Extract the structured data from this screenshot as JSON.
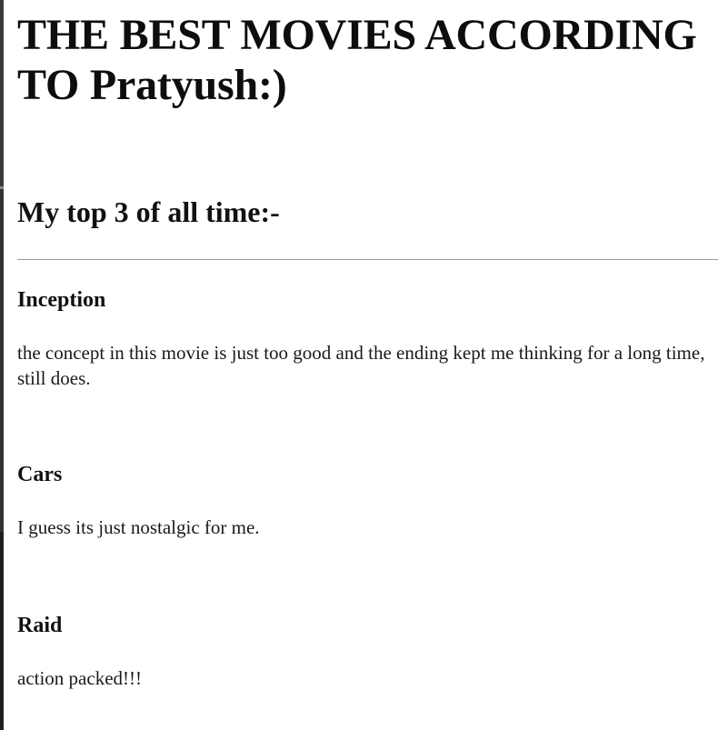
{
  "page": {
    "title": "THE BEST MOVIES ACCORDING TO Pratyush:)",
    "subtitle": "My top 3 of all time:-"
  },
  "movies": [
    {
      "title": "Inception",
      "description": "the concept in this movie is just too good and the ending kept me thinking for a long time, still does."
    },
    {
      "title": "Cars",
      "description": "I guess its just nostalgic for me."
    },
    {
      "title": "Raid",
      "description": "action packed!!!"
    }
  ]
}
